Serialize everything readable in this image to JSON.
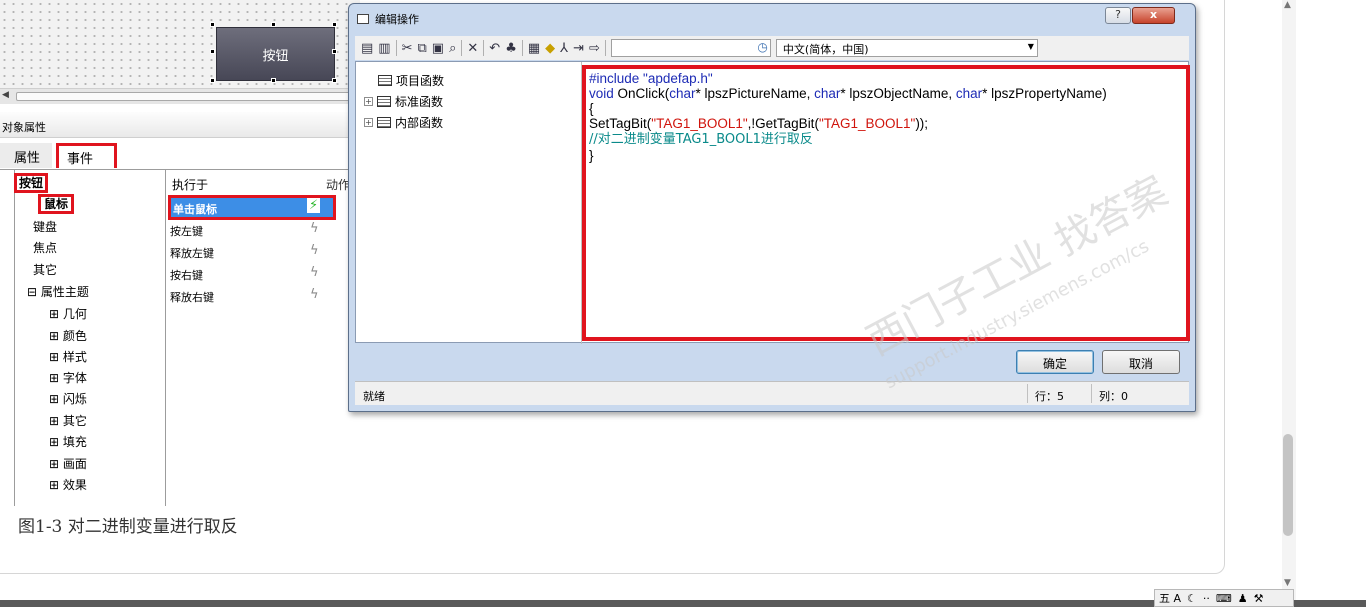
{
  "canvas": {
    "button_label": "按钮"
  },
  "properties": {
    "title": "对象属性",
    "tabs": [
      {
        "label": "属性"
      },
      {
        "label": "事件"
      }
    ],
    "tree": {
      "root": "按钮",
      "items": [
        "鼠标",
        "键盘",
        "焦点",
        "其它",
        "属性主题",
        "几何",
        "颜色",
        "样式",
        "字体",
        "闪烁",
        "其它",
        "填充",
        "画面",
        "效果"
      ]
    },
    "events": {
      "header_exec": "执行于",
      "header_action": "动作",
      "rows": [
        "单击鼠标",
        "按左键",
        "释放左键",
        "按右键",
        "释放右键"
      ]
    }
  },
  "caption": "图1-3 对二进制变量进行取反",
  "dialog": {
    "title": "编辑操作",
    "help": "?",
    "close": "x",
    "language": "中文(简体，中国)",
    "functions": [
      "项目函数",
      "标准函数",
      "内部函数"
    ],
    "code": {
      "line1": "#include \"apdefap.h\"",
      "line2_a": "void",
      "line2_b": " OnClick(",
      "line2_c": "char",
      "line2_d": "* lpszPictureName, ",
      "line2_e": "char",
      "line2_f": "* lpszObjectName, ",
      "line2_g": "char",
      "line2_h": "* lpszPropertyName)",
      "line3": "{",
      "line4_a": "SetTagBit(",
      "line4_b": "\"TAG1_BOOL1\"",
      "line4_c": ",!GetTagBit(",
      "line4_d": "\"TAG1_BOOL1\"",
      "line4_e": "));",
      "line5": "//对二进制变量TAG1_BOOL1进行取反",
      "line6": "}"
    },
    "ok": "确定",
    "cancel": "取消",
    "status": "就绪",
    "row": "行：5",
    "col": "列：0"
  },
  "watermark": {
    "main": "西门子工业 找答案",
    "url": "support.industry.siemens.com/cs"
  },
  "ime": {
    "label": "五 A"
  },
  "colors": {
    "highlight_red": "#e0141e",
    "selection_blue": "#3d8ee6",
    "code_blue": "#1d2bb5",
    "string_red": "#d0140c",
    "comment_teal": "#0a8a8a"
  }
}
